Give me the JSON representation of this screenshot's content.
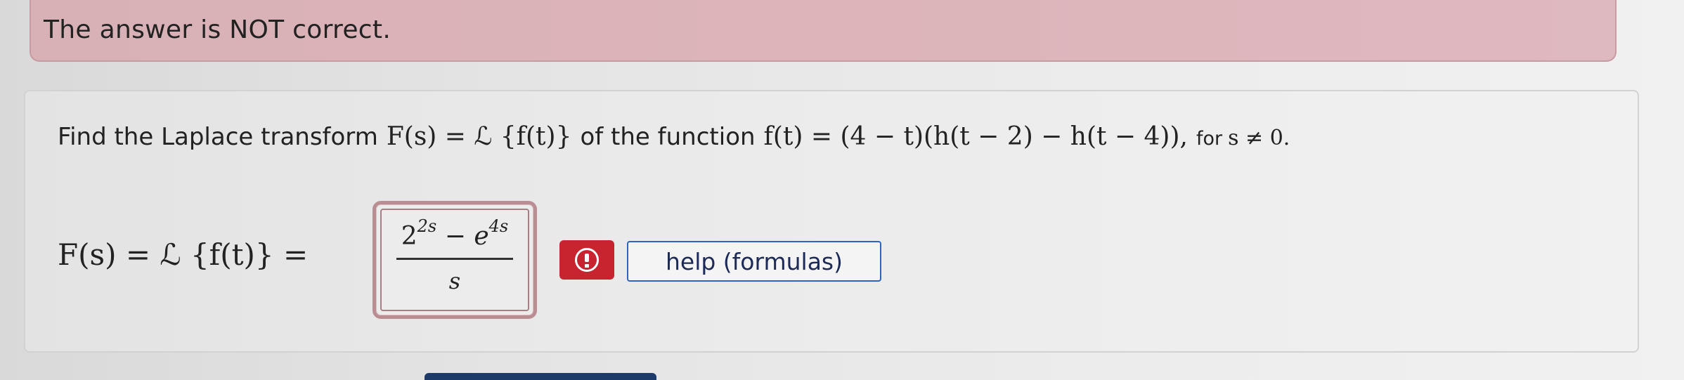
{
  "feedback": {
    "message": "The answer is NOT correct."
  },
  "question": {
    "prompt_prefix": "Find the Laplace transform",
    "prompt_transform_math": "F(s) = ℒ {f(t)}",
    "prompt_middle": "of the function",
    "prompt_function_math": "f(t) = (4 − t)(h(t − 2) − h(t − 4)),",
    "prompt_condition_prefix": "for",
    "prompt_condition_math": "s ≠ 0."
  },
  "answer": {
    "lhs_math": "F(s) = ℒ {f(t)} =",
    "value": {
      "numerator_base_1": "2",
      "numerator_exp_1": "2s",
      "numerator_operator": "−",
      "numerator_base_2": "e",
      "numerator_exp_2": "4s",
      "denominator": "s"
    },
    "status": "incorrect",
    "status_color": "#c8242f"
  },
  "help": {
    "label": "help (formulas)"
  },
  "colors": {
    "banner_background": "#dcb4ba",
    "banner_border": "#c99aa2",
    "help_border": "#2c63c4",
    "answer_box_border": "#b98d92"
  }
}
